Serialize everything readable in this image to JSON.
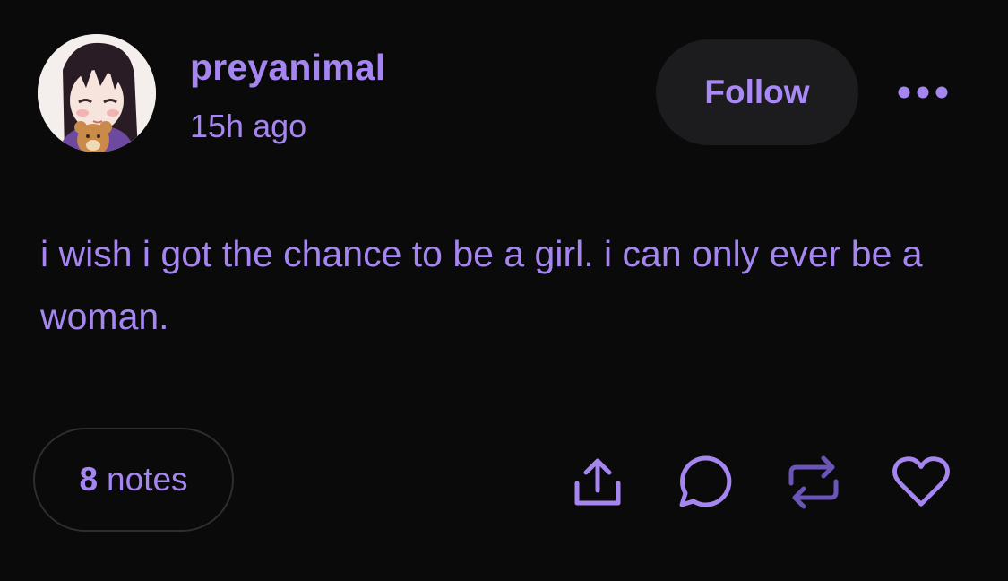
{
  "post": {
    "username": "preyanimal",
    "timestamp": "15h ago",
    "follow_label": "Follow",
    "body": "i wish i got the chance to be a girl. i can only ever be a woman.",
    "notes_count": "8",
    "notes_label": "notes"
  },
  "icons": {
    "more": "more-horizontal-icon",
    "share": "share-upload-icon",
    "reply": "speech-bubble-icon",
    "reblog": "reblog-arrows-icon",
    "like": "heart-icon"
  },
  "colors": {
    "background": "#0a0a0b",
    "accent": "#a586f0",
    "follow_bg": "#1c1c1e",
    "reblog_icon": "#6b55b8"
  }
}
